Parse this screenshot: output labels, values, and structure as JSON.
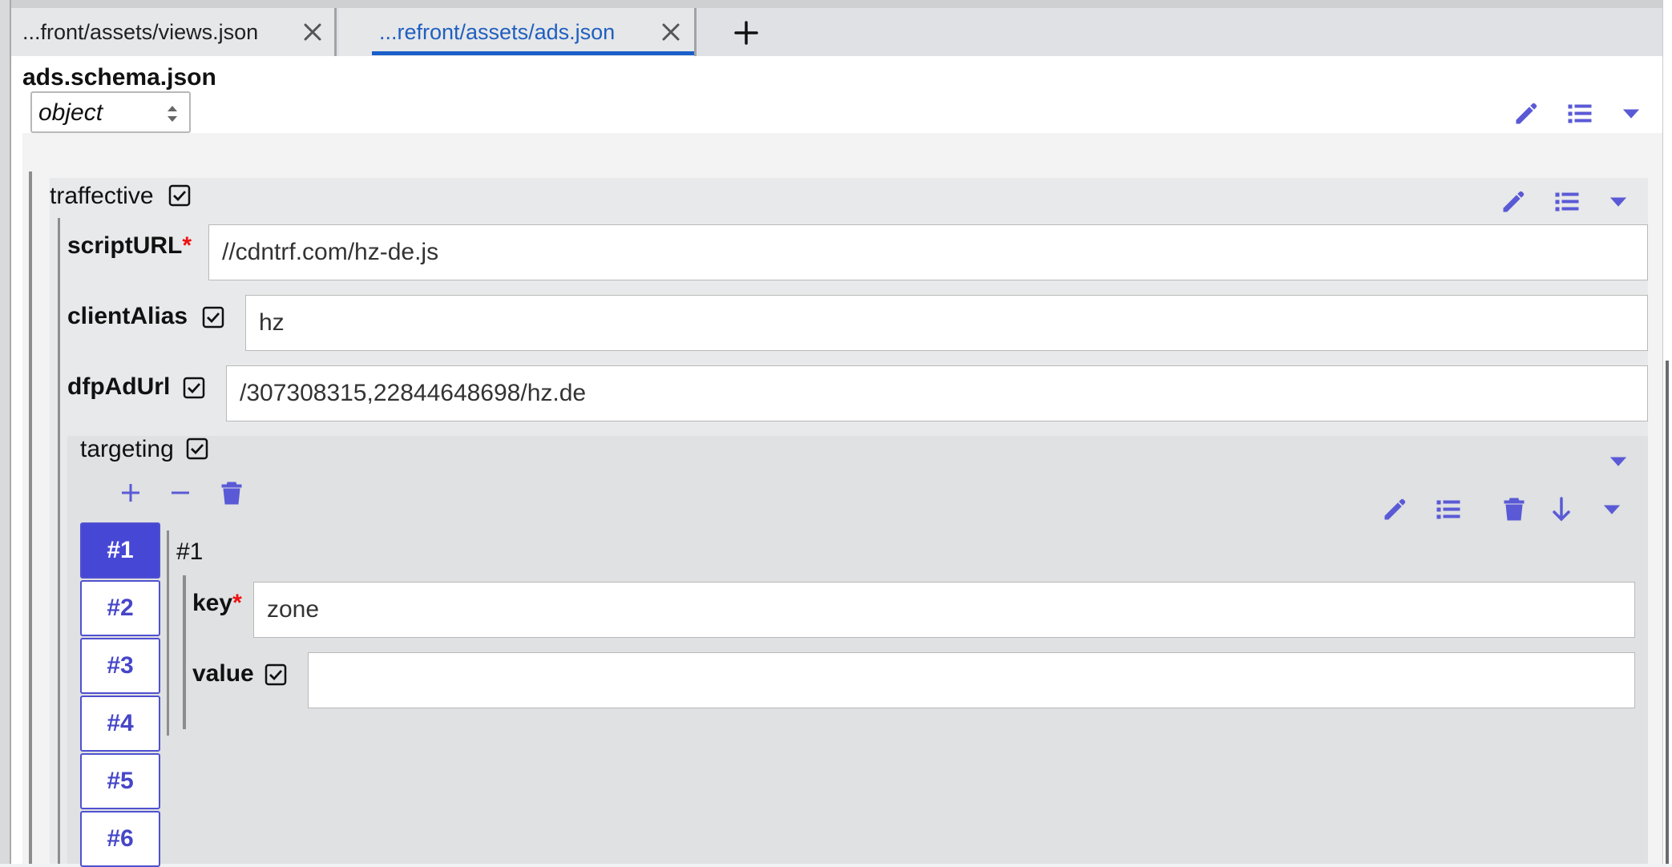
{
  "tabs": [
    {
      "label": "...front/assets/views.json",
      "active": false
    },
    {
      "label": "...refront/assets/ads.json",
      "active": true
    }
  ],
  "schema": {
    "title": "ads.schema.json",
    "type_value": "object"
  },
  "traffective": {
    "label": "traffective",
    "fields": {
      "scriptURL": {
        "label": "scriptURL",
        "required_mark": "*",
        "value": "//cdntrf.com/hz-de.js"
      },
      "clientAlias": {
        "label": "clientAlias",
        "value": "hz"
      },
      "dfpAdUrl": {
        "label": "dfpAdUrl",
        "value": "/307308315,22844648698/hz.de"
      }
    },
    "targeting": {
      "label": "targeting",
      "items": [
        "#1",
        "#2",
        "#3",
        "#4",
        "#5",
        "#6"
      ],
      "selected": "#1",
      "item_title": "#1",
      "key": {
        "label": "key",
        "required_mark": "*",
        "value": "zone"
      },
      "value": {
        "label": "value",
        "value": ""
      }
    }
  },
  "colors": {
    "accent": "#5a5ad6",
    "active_tab": "#1a5fc9",
    "required": "#ee1111"
  }
}
